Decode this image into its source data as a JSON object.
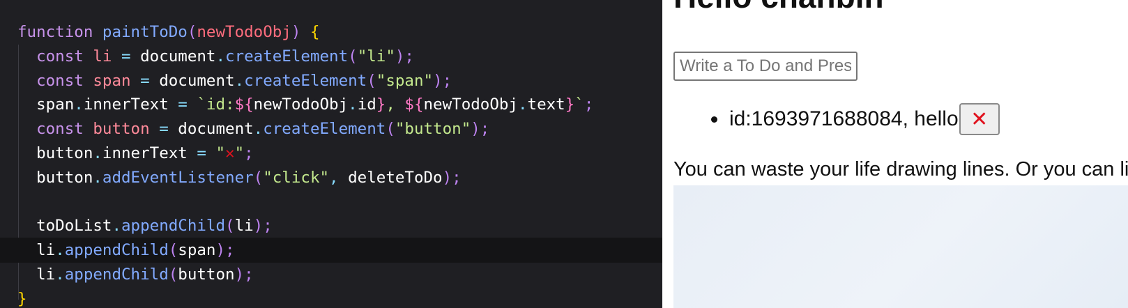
{
  "editor": {
    "lines": [
      {
        "tokens": [
          {
            "t": "function",
            "c": "kw"
          },
          {
            "t": " ",
            "c": "id"
          },
          {
            "t": "paintToDo",
            "c": "fn"
          },
          {
            "t": "(",
            "c": "pn"
          },
          {
            "t": "newTodoObj",
            "c": "prm"
          },
          {
            "t": ")",
            "c": "pn"
          },
          {
            "t": " ",
            "c": "id"
          },
          {
            "t": "{",
            "c": "br"
          }
        ]
      },
      {
        "tokens": [
          {
            "t": "  const",
            "c": "kw"
          },
          {
            "t": " ",
            "c": "id"
          },
          {
            "t": "li",
            "c": "vr"
          },
          {
            "t": " = ",
            "c": "op"
          },
          {
            "t": "document",
            "c": "id"
          },
          {
            "t": ".",
            "c": "op"
          },
          {
            "t": "createElement",
            "c": "fn"
          },
          {
            "t": "(",
            "c": "pn"
          },
          {
            "t": "\"li\"",
            "c": "str"
          },
          {
            "t": ");",
            "c": "pn"
          }
        ]
      },
      {
        "tokens": [
          {
            "t": "  const",
            "c": "kw"
          },
          {
            "t": " ",
            "c": "id"
          },
          {
            "t": "span",
            "c": "vr"
          },
          {
            "t": " = ",
            "c": "op"
          },
          {
            "t": "document",
            "c": "id"
          },
          {
            "t": ".",
            "c": "op"
          },
          {
            "t": "createElement",
            "c": "fn"
          },
          {
            "t": "(",
            "c": "pn"
          },
          {
            "t": "\"span\"",
            "c": "str"
          },
          {
            "t": ");",
            "c": "pn"
          }
        ]
      },
      {
        "tokens": [
          {
            "t": "  span",
            "c": "id"
          },
          {
            "t": ".",
            "c": "op"
          },
          {
            "t": "innerText",
            "c": "id"
          },
          {
            "t": " = ",
            "c": "op"
          },
          {
            "t": "`id:",
            "c": "str"
          },
          {
            "t": "${",
            "c": "tpl"
          },
          {
            "t": "newTodoObj",
            "c": "id"
          },
          {
            "t": ".",
            "c": "op"
          },
          {
            "t": "id",
            "c": "id"
          },
          {
            "t": "}",
            "c": "tpl"
          },
          {
            "t": ", ",
            "c": "str"
          },
          {
            "t": "${",
            "c": "tpl"
          },
          {
            "t": "newTodoObj",
            "c": "id"
          },
          {
            "t": ".",
            "c": "op"
          },
          {
            "t": "text",
            "c": "id"
          },
          {
            "t": "}",
            "c": "tpl"
          },
          {
            "t": "`",
            "c": "str"
          },
          {
            "t": ";",
            "c": "pn"
          }
        ]
      },
      {
        "tokens": [
          {
            "t": "  const",
            "c": "kw"
          },
          {
            "t": " ",
            "c": "id"
          },
          {
            "t": "button",
            "c": "vr"
          },
          {
            "t": " = ",
            "c": "op"
          },
          {
            "t": "document",
            "c": "id"
          },
          {
            "t": ".",
            "c": "op"
          },
          {
            "t": "createElement",
            "c": "fn"
          },
          {
            "t": "(",
            "c": "pn"
          },
          {
            "t": "\"button\"",
            "c": "str"
          },
          {
            "t": ");",
            "c": "pn"
          }
        ]
      },
      {
        "tokens": [
          {
            "t": "  button",
            "c": "id"
          },
          {
            "t": ".",
            "c": "op"
          },
          {
            "t": "innerText",
            "c": "id"
          },
          {
            "t": " = ",
            "c": "op"
          },
          {
            "t": "\"",
            "c": "str"
          },
          {
            "t": "✕",
            "c": "x-red"
          },
          {
            "t": "\"",
            "c": "str"
          },
          {
            "t": ";",
            "c": "pn"
          }
        ]
      },
      {
        "tokens": [
          {
            "t": "  button",
            "c": "id"
          },
          {
            "t": ".",
            "c": "op"
          },
          {
            "t": "addEventListener",
            "c": "fn"
          },
          {
            "t": "(",
            "c": "pn"
          },
          {
            "t": "\"click\"",
            "c": "str"
          },
          {
            "t": ", ",
            "c": "op"
          },
          {
            "t": "deleteToDo",
            "c": "id"
          },
          {
            "t": ");",
            "c": "pn"
          }
        ]
      },
      {
        "tokens": []
      },
      {
        "tokens": [
          {
            "t": "  toDoList",
            "c": "id"
          },
          {
            "t": ".",
            "c": "op"
          },
          {
            "t": "appendChild",
            "c": "fn"
          },
          {
            "t": "(",
            "c": "pn"
          },
          {
            "t": "li",
            "c": "id"
          },
          {
            "t": ");",
            "c": "pn"
          }
        ]
      },
      {
        "tokens": [
          {
            "t": "  li",
            "c": "id"
          },
          {
            "t": ".",
            "c": "op"
          },
          {
            "t": "appendChild",
            "c": "fn"
          },
          {
            "t": "(",
            "c": "pn"
          },
          {
            "t": "span",
            "c": "id"
          },
          {
            "t": ");",
            "c": "pn"
          }
        ],
        "current": true
      },
      {
        "tokens": [
          {
            "t": "  li",
            "c": "id"
          },
          {
            "t": ".",
            "c": "op"
          },
          {
            "t": "appendChild",
            "c": "fn"
          },
          {
            "t": "(",
            "c": "pn"
          },
          {
            "t": "button",
            "c": "id"
          },
          {
            "t": ");",
            "c": "pn"
          }
        ]
      },
      {
        "tokens": [
          {
            "t": "}",
            "c": "br"
          }
        ]
      }
    ]
  },
  "browser": {
    "greeting": "Hello chanbin",
    "input_placeholder": "Write a To Do and Press Enter",
    "todos": [
      {
        "text": "id:1693971688084, hello",
        "delete_label": "✕"
      }
    ],
    "quote": "You can waste your life drawing lines. Or you can live your life crossing them."
  }
}
